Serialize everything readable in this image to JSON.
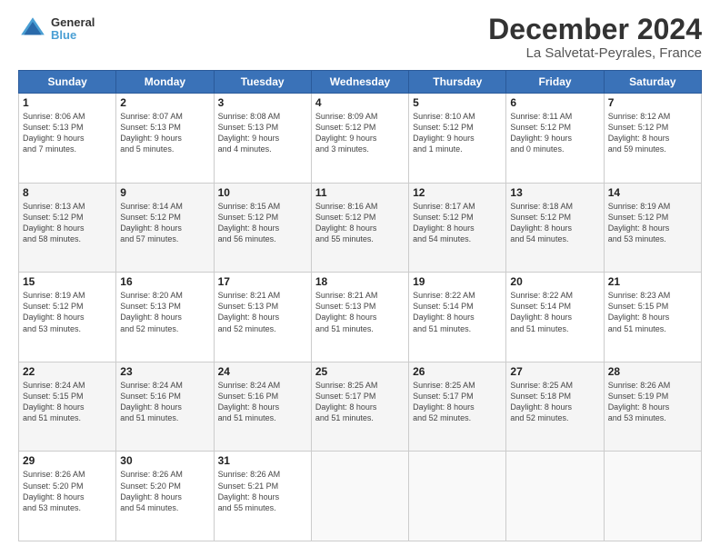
{
  "header": {
    "logo_line1": "General",
    "logo_line2": "Blue",
    "title": "December 2024",
    "subtitle": "La Salvetat-Peyrales, France"
  },
  "days_of_week": [
    "Sunday",
    "Monday",
    "Tuesday",
    "Wednesday",
    "Thursday",
    "Friday",
    "Saturday"
  ],
  "weeks": [
    [
      {
        "day": "1",
        "detail": "Sunrise: 8:06 AM\nSunset: 5:13 PM\nDaylight: 9 hours\nand 7 minutes."
      },
      {
        "day": "2",
        "detail": "Sunrise: 8:07 AM\nSunset: 5:13 PM\nDaylight: 9 hours\nand 5 minutes."
      },
      {
        "day": "3",
        "detail": "Sunrise: 8:08 AM\nSunset: 5:13 PM\nDaylight: 9 hours\nand 4 minutes."
      },
      {
        "day": "4",
        "detail": "Sunrise: 8:09 AM\nSunset: 5:12 PM\nDaylight: 9 hours\nand 3 minutes."
      },
      {
        "day": "5",
        "detail": "Sunrise: 8:10 AM\nSunset: 5:12 PM\nDaylight: 9 hours\nand 1 minute."
      },
      {
        "day": "6",
        "detail": "Sunrise: 8:11 AM\nSunset: 5:12 PM\nDaylight: 9 hours\nand 0 minutes."
      },
      {
        "day": "7",
        "detail": "Sunrise: 8:12 AM\nSunset: 5:12 PM\nDaylight: 8 hours\nand 59 minutes."
      }
    ],
    [
      {
        "day": "8",
        "detail": "Sunrise: 8:13 AM\nSunset: 5:12 PM\nDaylight: 8 hours\nand 58 minutes."
      },
      {
        "day": "9",
        "detail": "Sunrise: 8:14 AM\nSunset: 5:12 PM\nDaylight: 8 hours\nand 57 minutes."
      },
      {
        "day": "10",
        "detail": "Sunrise: 8:15 AM\nSunset: 5:12 PM\nDaylight: 8 hours\nand 56 minutes."
      },
      {
        "day": "11",
        "detail": "Sunrise: 8:16 AM\nSunset: 5:12 PM\nDaylight: 8 hours\nand 55 minutes."
      },
      {
        "day": "12",
        "detail": "Sunrise: 8:17 AM\nSunset: 5:12 PM\nDaylight: 8 hours\nand 54 minutes."
      },
      {
        "day": "13",
        "detail": "Sunrise: 8:18 AM\nSunset: 5:12 PM\nDaylight: 8 hours\nand 54 minutes."
      },
      {
        "day": "14",
        "detail": "Sunrise: 8:19 AM\nSunset: 5:12 PM\nDaylight: 8 hours\nand 53 minutes."
      }
    ],
    [
      {
        "day": "15",
        "detail": "Sunrise: 8:19 AM\nSunset: 5:12 PM\nDaylight: 8 hours\nand 53 minutes."
      },
      {
        "day": "16",
        "detail": "Sunrise: 8:20 AM\nSunset: 5:13 PM\nDaylight: 8 hours\nand 52 minutes."
      },
      {
        "day": "17",
        "detail": "Sunrise: 8:21 AM\nSunset: 5:13 PM\nDaylight: 8 hours\nand 52 minutes."
      },
      {
        "day": "18",
        "detail": "Sunrise: 8:21 AM\nSunset: 5:13 PM\nDaylight: 8 hours\nand 51 minutes."
      },
      {
        "day": "19",
        "detail": "Sunrise: 8:22 AM\nSunset: 5:14 PM\nDaylight: 8 hours\nand 51 minutes."
      },
      {
        "day": "20",
        "detail": "Sunrise: 8:22 AM\nSunset: 5:14 PM\nDaylight: 8 hours\nand 51 minutes."
      },
      {
        "day": "21",
        "detail": "Sunrise: 8:23 AM\nSunset: 5:15 PM\nDaylight: 8 hours\nand 51 minutes."
      }
    ],
    [
      {
        "day": "22",
        "detail": "Sunrise: 8:24 AM\nSunset: 5:15 PM\nDaylight: 8 hours\nand 51 minutes."
      },
      {
        "day": "23",
        "detail": "Sunrise: 8:24 AM\nSunset: 5:16 PM\nDaylight: 8 hours\nand 51 minutes."
      },
      {
        "day": "24",
        "detail": "Sunrise: 8:24 AM\nSunset: 5:16 PM\nDaylight: 8 hours\nand 51 minutes."
      },
      {
        "day": "25",
        "detail": "Sunrise: 8:25 AM\nSunset: 5:17 PM\nDaylight: 8 hours\nand 51 minutes."
      },
      {
        "day": "26",
        "detail": "Sunrise: 8:25 AM\nSunset: 5:17 PM\nDaylight: 8 hours\nand 52 minutes."
      },
      {
        "day": "27",
        "detail": "Sunrise: 8:25 AM\nSunset: 5:18 PM\nDaylight: 8 hours\nand 52 minutes."
      },
      {
        "day": "28",
        "detail": "Sunrise: 8:26 AM\nSunset: 5:19 PM\nDaylight: 8 hours\nand 53 minutes."
      }
    ],
    [
      {
        "day": "29",
        "detail": "Sunrise: 8:26 AM\nSunset: 5:20 PM\nDaylight: 8 hours\nand 53 minutes."
      },
      {
        "day": "30",
        "detail": "Sunrise: 8:26 AM\nSunset: 5:20 PM\nDaylight: 8 hours\nand 54 minutes."
      },
      {
        "day": "31",
        "detail": "Sunrise: 8:26 AM\nSunset: 5:21 PM\nDaylight: 8 hours\nand 55 minutes."
      },
      {
        "day": "",
        "detail": ""
      },
      {
        "day": "",
        "detail": ""
      },
      {
        "day": "",
        "detail": ""
      },
      {
        "day": "",
        "detail": ""
      }
    ]
  ]
}
